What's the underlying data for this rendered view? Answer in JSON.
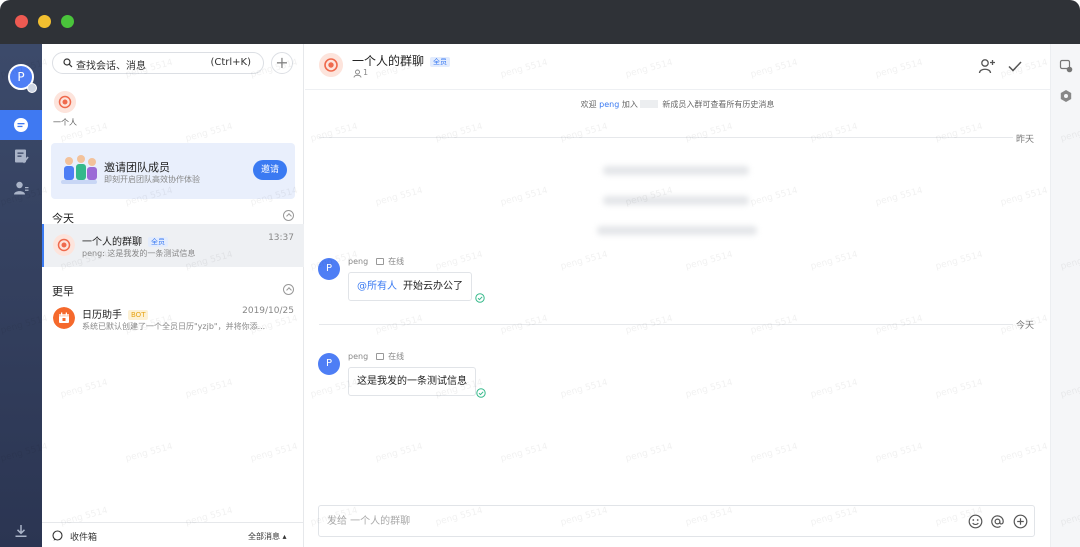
{
  "window": {
    "controls": [
      "close",
      "minimize",
      "maximize"
    ]
  },
  "user": {
    "avatar_letter": "P"
  },
  "leftnav": {
    "items": [
      {
        "name": "chat",
        "active": true
      },
      {
        "name": "tasks",
        "active": false
      },
      {
        "name": "contacts",
        "active": false
      },
      {
        "name": "download",
        "active": false
      }
    ]
  },
  "sidebar": {
    "search_placeholder": "查找会话、消息",
    "search_shortcut": "(Ctrl+K)",
    "add_label": "+",
    "pinned": {
      "label": "一个人"
    },
    "invite": {
      "title": "邀请团队成员",
      "subtitle": "即刻开启团队高效协作体验",
      "button": "邀请"
    },
    "sections": [
      {
        "title": "今天",
        "items": [
          {
            "name": "一个人的群聊",
            "tag": "全员",
            "time": "13:37",
            "preview": "peng: 这是我发的一条测试信息"
          }
        ]
      },
      {
        "title": "更早",
        "items": [
          {
            "name": "日历助手",
            "tag": "BOT",
            "time": "2019/10/25",
            "preview": "系统已默认创建了一个全员日历\"yzjb\"，并将你添..."
          }
        ]
      }
    ],
    "footer": {
      "inbox": "收件箱",
      "filter": "全部消息 ▴"
    }
  },
  "chat": {
    "title": "一个人的群聊",
    "tag": "全员",
    "member_count": "1",
    "system_notice": {
      "prefix": "欢迎",
      "user": "peng",
      "joined": "加入",
      "suffix": "新成员入群可查看所有历史消息"
    },
    "date_yesterday": "昨天",
    "date_today": "今天",
    "messages": [
      {
        "sender": "peng",
        "avatar": "P",
        "status": "在线",
        "mention": "@所有人",
        "text": "开始云办公了"
      },
      {
        "sender": "peng",
        "avatar": "P",
        "status": "在线",
        "text": "这是我发的一条测试信息"
      }
    ],
    "composer_placeholder": "发给 一个人的群聊"
  },
  "watermark": {
    "text": "peng 5514"
  },
  "colors": {
    "accent": "#3a7af2",
    "sidebar_dark": "#2f3a57",
    "titlebar": "#2f3237",
    "avatar_blue": "#4e7ef5",
    "calendar_orange": "#f5692c",
    "group_red": "#ef6a4d",
    "read_green": "#35b98a"
  }
}
